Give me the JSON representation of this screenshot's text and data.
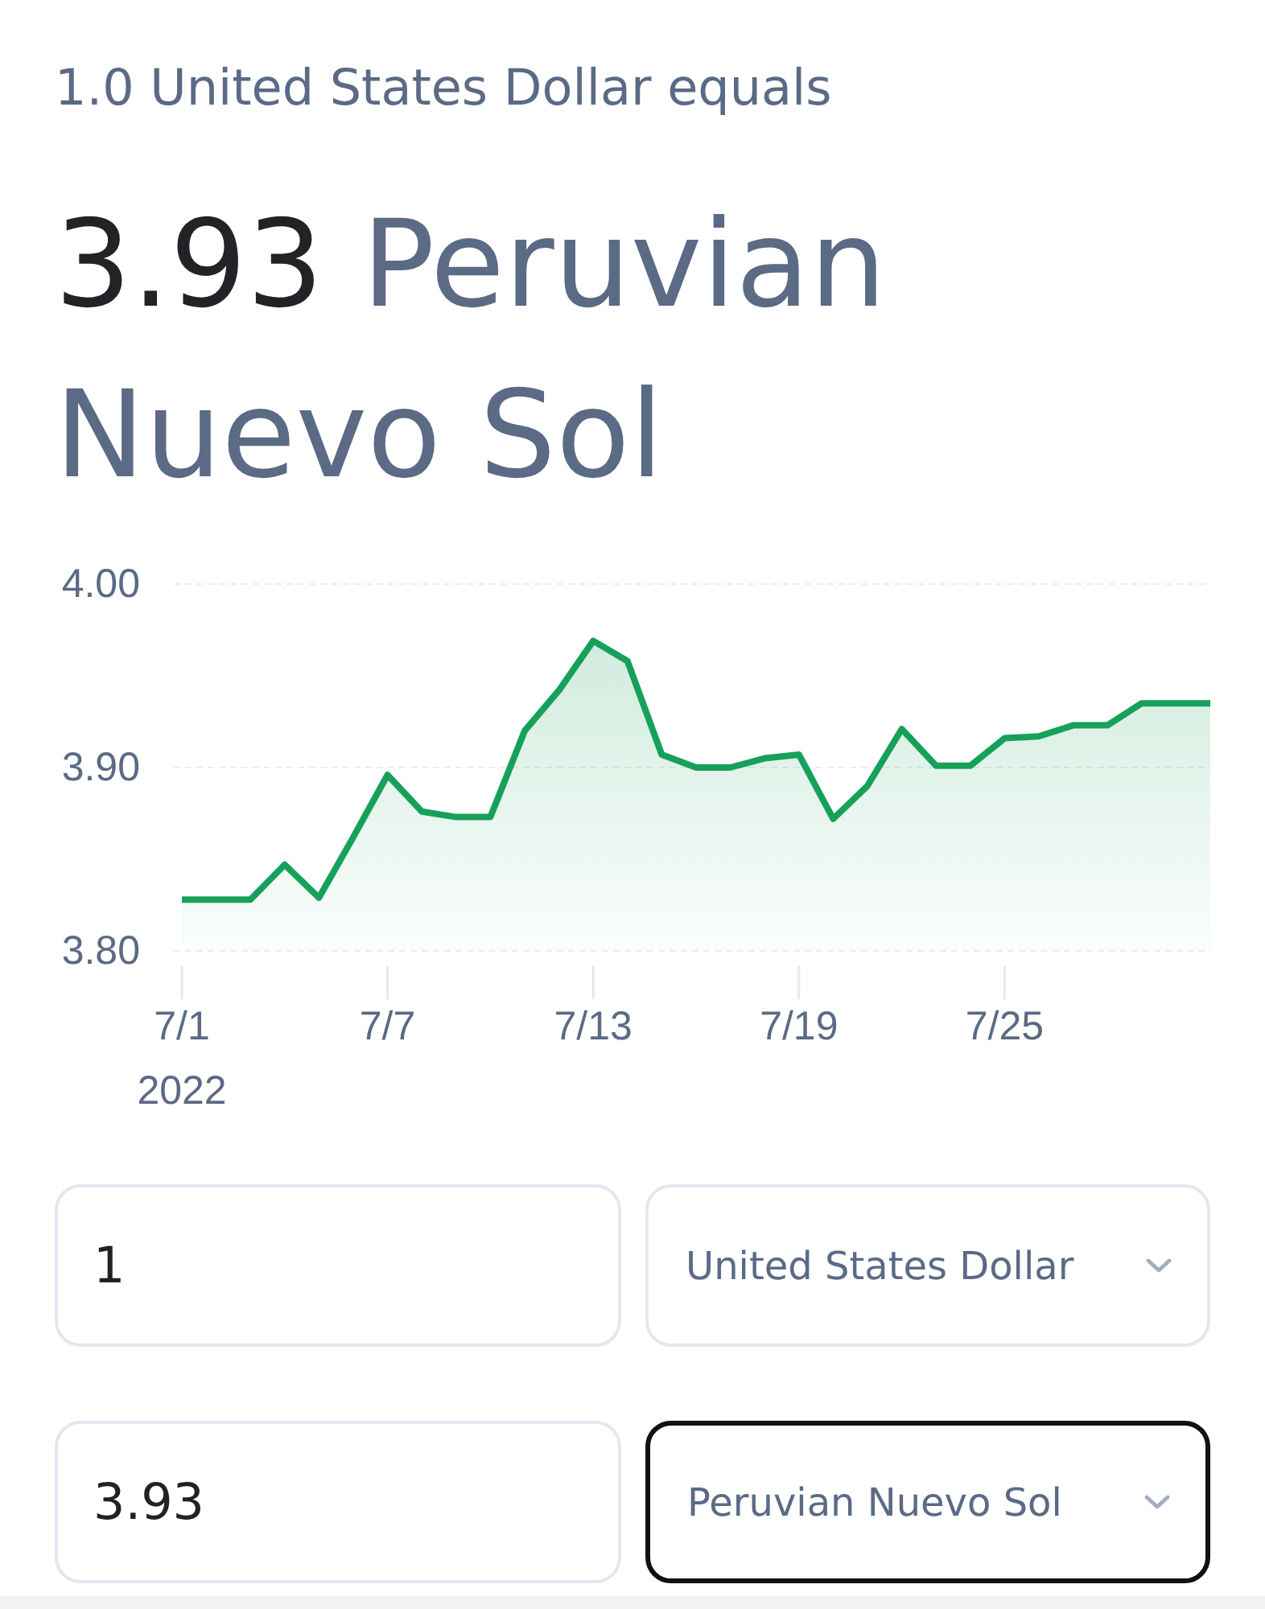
{
  "summary": {
    "base_text": "1.0 United States Dollar equals",
    "rate": "3.93",
    "target_currency": "Peruvian Nuevo Sol"
  },
  "chart": {
    "year_label": "2022",
    "chart_data": {
      "type": "area",
      "categories": [
        "7/1",
        null,
        null,
        null,
        null,
        null,
        "7/7",
        null,
        null,
        null,
        null,
        null,
        "7/13",
        null,
        null,
        null,
        null,
        null,
        "7/19",
        null,
        null,
        null,
        null,
        null,
        "7/25",
        null,
        null,
        null,
        null,
        null,
        null
      ],
      "series": [
        {
          "color": "#17a05a",
          "values": [
            3.828,
            3.828,
            3.828,
            3.847,
            3.829,
            3.862,
            3.896,
            3.876,
            3.873,
            3.873,
            3.92,
            3.942,
            3.969,
            3.958,
            3.907,
            3.9,
            3.9,
            3.905,
            3.907,
            3.872,
            3.89,
            3.921,
            3.901,
            3.901,
            3.916,
            3.917,
            3.923,
            3.923,
            3.935,
            3.935,
            3.935
          ]
        }
      ],
      "ylim": [
        3.8,
        4.0
      ],
      "yticks": [
        {
          "value": 3.8,
          "label": "3.80"
        },
        {
          "value": 3.9,
          "label": "3.90"
        },
        {
          "value": 4.0,
          "label": "4.00"
        }
      ]
    }
  },
  "converter": [
    {
      "amount": "1",
      "currency": "United States Dollar",
      "focused": false
    },
    {
      "amount": "3.93",
      "currency": "Peruvian Nuevo Sol",
      "focused": true
    }
  ]
}
